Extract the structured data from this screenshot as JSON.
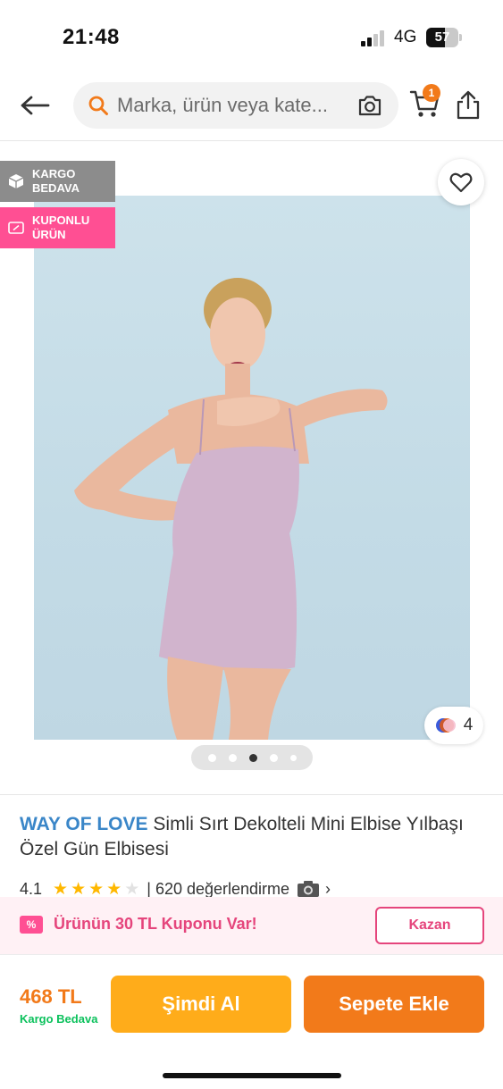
{
  "status_bar": {
    "time": "21:48",
    "network": "4G",
    "battery_level": "57",
    "battery_percent": 57
  },
  "header": {
    "search_placeholder": "Marka, ürün veya kate...",
    "cart_count": "1",
    "icons": [
      "back-arrow-icon",
      "search-icon",
      "camera-icon",
      "cart-icon",
      "share-icon"
    ]
  },
  "gallery": {
    "badges": [
      {
        "line1": "KARGO",
        "line2": "BEDAVA",
        "color": "#8c8c8c"
      },
      {
        "line1": "KUPONLU",
        "line2": "ÜRÜN",
        "color": "#ff4f93"
      }
    ],
    "color_count": "4",
    "page_count": 5,
    "active_page": 3
  },
  "product": {
    "brand": "WAY OF LOVE",
    "name": "Simli Sırt Dekolteli Mini Elbise Yılbaşı Özel Gün Elbisesi",
    "rating": "4.1",
    "stars_filled": 4,
    "stars_total": 5,
    "reviews": "| 620 değerlendirme"
  },
  "coupon": {
    "icon_text": "%",
    "text": "Ürünün 30 TL Kuponu Var!",
    "button": "Kazan"
  },
  "bottom_bar": {
    "price": "468 TL",
    "shipping": "Kargo Bedava",
    "buy_now": "Şimdi Al",
    "add_to_cart": "Sepete Ekle"
  },
  "colors": {
    "accent": "#f27a1a",
    "buy_now": "#ffac1a",
    "brand_link": "#3a86c8",
    "coupon_pink": "#e5457c",
    "shipping_green": "#0bc15c"
  }
}
